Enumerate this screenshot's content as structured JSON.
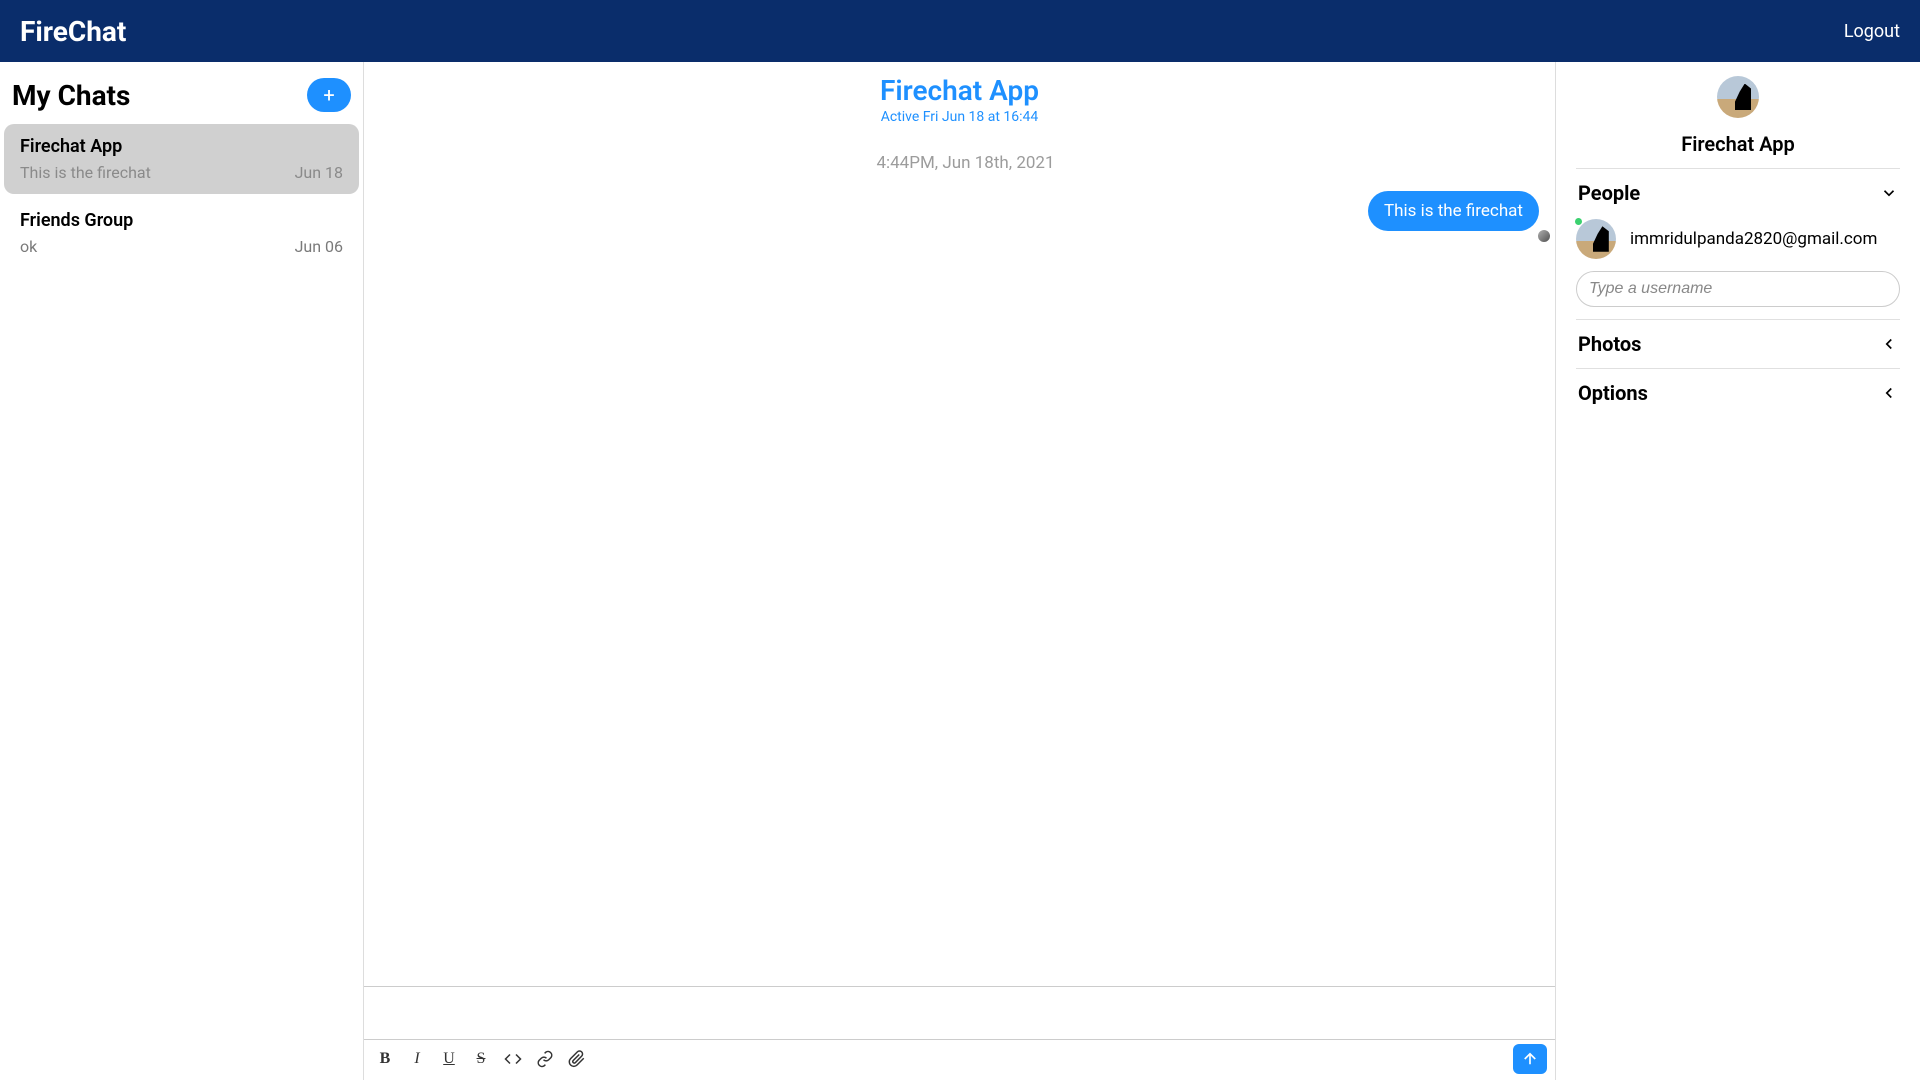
{
  "header": {
    "brand": "FireChat",
    "logout": "Logout"
  },
  "sidebar": {
    "title": "My Chats",
    "newChatIcon": "plus-icon",
    "chats": [
      {
        "title": "Firechat App",
        "preview": "This is the firechat",
        "date": "Jun 18",
        "active": true
      },
      {
        "title": "Friends Group",
        "preview": "ok",
        "date": "Jun 06",
        "active": false
      }
    ]
  },
  "conversation": {
    "title": "Firechat App",
    "status": "Active Fri Jun 18 at 16:44",
    "dateSeparator": "4:44PM, Jun 18th, 2021",
    "messages": [
      {
        "text": "This is the firechat",
        "mine": true
      }
    ],
    "composer": {
      "value": "",
      "placeholder": "",
      "formatButtons": [
        "bold",
        "italic",
        "underline",
        "strike",
        "code",
        "link",
        "attach"
      ],
      "sendIcon": "arrow-up-icon"
    }
  },
  "details": {
    "title": "Firechat App",
    "sections": {
      "people": {
        "label": "People",
        "expanded": true,
        "members": [
          {
            "name": "immridulpanda2820@gmail.com",
            "online": true
          }
        ],
        "searchPlaceholder": "Type a username"
      },
      "photos": {
        "label": "Photos",
        "expanded": false
      },
      "options": {
        "label": "Options",
        "expanded": false
      }
    }
  },
  "colors": {
    "headerBg": "#0a2d6b",
    "accent": "#1e90ff"
  }
}
